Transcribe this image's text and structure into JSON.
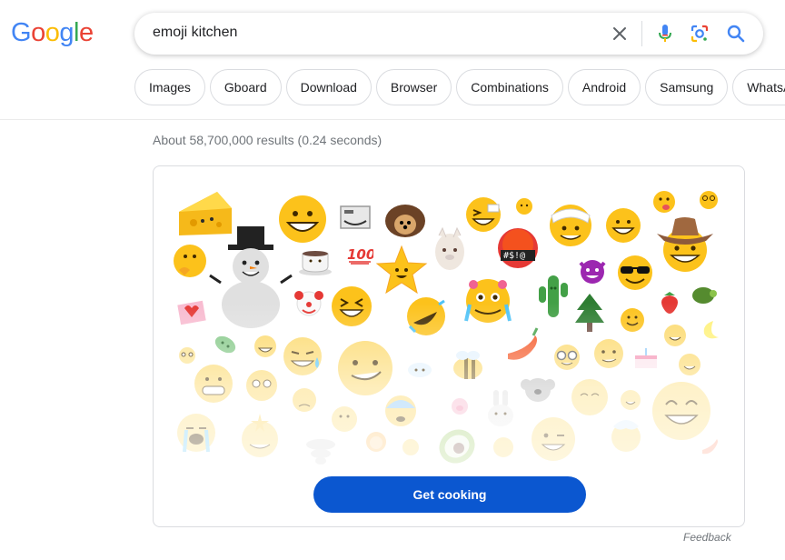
{
  "logo": {
    "letters": [
      "G",
      "o",
      "o",
      "g",
      "l",
      "e"
    ],
    "colors": [
      "#4285F4",
      "#EA4335",
      "#FBBC05",
      "#4285F4",
      "#34A853",
      "#EA4335"
    ]
  },
  "search": {
    "query": "emoji kitchen"
  },
  "icons": {
    "clear": "close-icon",
    "voice": "microphone-icon",
    "lens": "lens-icon",
    "search": "search-icon"
  },
  "chips": [
    "Images",
    "Gboard",
    "Download",
    "Browser",
    "Combinations",
    "Android",
    "Samsung",
    "WhatsApp"
  ],
  "results": {
    "stats": "About 58,700,000 results (0.24 seconds)"
  },
  "kitchen_card": {
    "button_label": "Get cooking",
    "button_color": "#0b57d0"
  },
  "feedback": {
    "label": "Feedback"
  }
}
